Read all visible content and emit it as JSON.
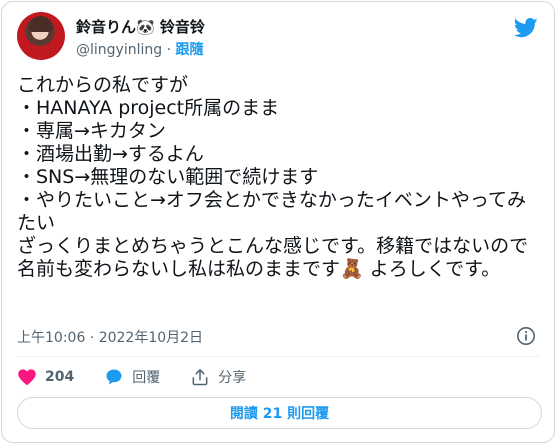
{
  "header": {
    "display_name": "鈴音りん🐼 铃音铃",
    "handle": "@lingyinling",
    "separator": " · ",
    "follow_label": "跟隨"
  },
  "tweet": {
    "text": "これからの私ですが\n・HANAYA project所属のまま\n・専属→キカタン\n・酒場出勤→するよん\n・SNS→無理のない範囲で続けます\n・やりたいこと→オフ会とかできなかったイベントやってみたい\nざっくりまとめちゃうとこんな感じです。移籍ではないので名前も変わらないし私は私のままです🧸 よろしくです。",
    "timestamp": "上午10:06 · 2022年10月2日"
  },
  "actions": {
    "like_count": "204",
    "reply_label": "回覆",
    "share_label": "分享"
  },
  "read_replies_label": "閱讀 21 則回覆",
  "colors": {
    "accent": "#1d9bf0",
    "like": "#f91880",
    "text": "#0f1419",
    "secondary": "#536471",
    "border": "#cfd9de"
  },
  "icons": [
    "avatar",
    "twitter-bird-icon",
    "info-icon",
    "heart-icon",
    "reply-bubble-icon",
    "share-icon"
  ]
}
